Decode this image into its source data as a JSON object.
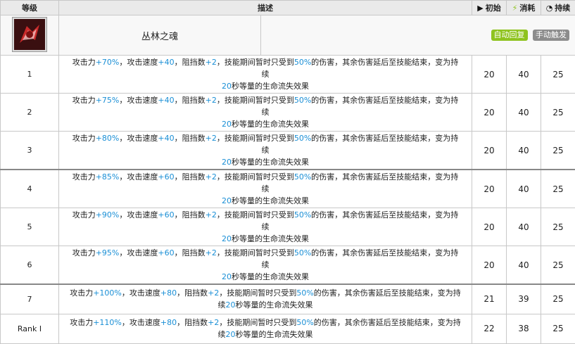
{
  "skill": {
    "name": "丛林之魂",
    "tags": [
      "自动回复",
      "手动触发"
    ]
  },
  "headers": {
    "level": "等级",
    "description": "描述",
    "initial": "初始",
    "cost": "消耗",
    "duration": "持续"
  },
  "colors": {
    "highlight": "#1a8fd6",
    "tag_auto": "#8fc31f",
    "tag_manual": "#8c8c8c"
  },
  "rows": [
    {
      "level": "1",
      "line1": [
        "攻击力",
        "+70%",
        "，攻击速度",
        "+40",
        "，阻挡数",
        "+2",
        "，技能期间暂时只受到",
        "50%",
        "的伤害，其余伤害延后至技能结束，变为持续"
      ],
      "line2": [
        "20",
        "秒等量的生命流失效果"
      ],
      "initial": "20",
      "cost": "40",
      "duration": "25"
    },
    {
      "level": "2",
      "line1": [
        "攻击力",
        "+75%",
        "，攻击速度",
        "+40",
        "，阻挡数",
        "+2",
        "，技能期间暂时只受到",
        "50%",
        "的伤害，其余伤害延后至技能结束，变为持续"
      ],
      "line2": [
        "20",
        "秒等量的生命流失效果"
      ],
      "initial": "20",
      "cost": "40",
      "duration": "25"
    },
    {
      "level": "3",
      "line1": [
        "攻击力",
        "+80%",
        "，攻击速度",
        "+40",
        "，阻挡数",
        "+2",
        "，技能期间暂时只受到",
        "50%",
        "的伤害，其余伤害延后至技能结束，变为持续"
      ],
      "line2": [
        "20",
        "秒等量的生命流失效果"
      ],
      "initial": "20",
      "cost": "40",
      "duration": "25"
    },
    {
      "level": "4",
      "line1": [
        "攻击力",
        "+85%",
        "，攻击速度",
        "+60",
        "，阻挡数",
        "+2",
        "，技能期间暂时只受到",
        "50%",
        "的伤害，其余伤害延后至技能结束，变为持续"
      ],
      "line2": [
        "20",
        "秒等量的生命流失效果"
      ],
      "initial": "20",
      "cost": "40",
      "duration": "25"
    },
    {
      "level": "5",
      "line1": [
        "攻击力",
        "+90%",
        "，攻击速度",
        "+60",
        "，阻挡数",
        "+2",
        "，技能期间暂时只受到",
        "50%",
        "的伤害，其余伤害延后至技能结束，变为持续"
      ],
      "line2": [
        "20",
        "秒等量的生命流失效果"
      ],
      "initial": "20",
      "cost": "40",
      "duration": "25"
    },
    {
      "level": "6",
      "line1": [
        "攻击力",
        "+95%",
        "，攻击速度",
        "+60",
        "，阻挡数",
        "+2",
        "，技能期间暂时只受到",
        "50%",
        "的伤害，其余伤害延后至技能结束，变为持续"
      ],
      "line2": [
        "20",
        "秒等量的生命流失效果"
      ],
      "initial": "20",
      "cost": "40",
      "duration": "25"
    },
    {
      "level": "7",
      "line1": [
        "攻击力",
        "+100%",
        "，攻击速度",
        "+80",
        "，阻挡数",
        "+2",
        "，技能期间暂时只受到",
        "50%",
        "的伤害，其余伤害延后至技能结束，变为持"
      ],
      "line2": [
        "续",
        "20",
        "秒等量的生命流失效果"
      ],
      "initial": "21",
      "cost": "39",
      "duration": "25"
    },
    {
      "level": "Rank Ⅰ",
      "line1": [
        "攻击力",
        "+110%",
        "，攻击速度",
        "+80",
        "，阻挡数",
        "+2",
        "，技能期间暂时只受到",
        "50%",
        "的伤害，其余伤害延后至技能结束，变为持"
      ],
      "line2": [
        "续",
        "20",
        "秒等量的生命流失效果"
      ],
      "initial": "22",
      "cost": "38",
      "duration": "25"
    }
  ]
}
